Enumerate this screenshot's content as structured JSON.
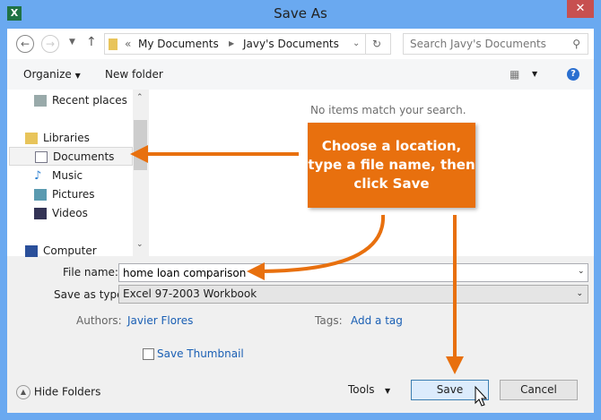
{
  "window": {
    "title": "Save As",
    "app_icon": "excel-icon",
    "close": "✕"
  },
  "nav": {
    "breadcrumb_prefix": "«",
    "path": [
      "My Documents",
      "Javy's Documents"
    ],
    "search_placeholder": "Search Javy's Documents"
  },
  "toolbar": {
    "organize": "Organize",
    "new_folder": "New folder"
  },
  "navpane": {
    "items": [
      {
        "label": "Recent places",
        "icon": "recent-places-icon"
      },
      {
        "label": "Libraries",
        "icon": "libraries-icon"
      },
      {
        "label": "Documents",
        "icon": "documents-icon",
        "selected": true
      },
      {
        "label": "Music",
        "icon": "music-icon"
      },
      {
        "label": "Pictures",
        "icon": "pictures-icon"
      },
      {
        "label": "Videos",
        "icon": "videos-icon"
      },
      {
        "label": "Computer",
        "icon": "computer-icon"
      }
    ]
  },
  "main": {
    "empty_message": "No items match your search."
  },
  "form": {
    "file_name_label": "File name:",
    "file_name": "home loan comparison",
    "type_label": "Save as type:",
    "type": "Excel 97-2003 Workbook",
    "authors_label": "Authors:",
    "authors": "Javier Flores",
    "tags_label": "Tags:",
    "tags": "Add a tag",
    "thumbnail_label": "Save Thumbnail",
    "thumbnail_checked": false
  },
  "footer": {
    "hide_folders": "Hide Folders",
    "tools": "Tools",
    "save": "Save",
    "cancel": "Cancel"
  },
  "callout": {
    "text": "Choose a location, type a file name, then click Save",
    "color": "#e8700e"
  }
}
